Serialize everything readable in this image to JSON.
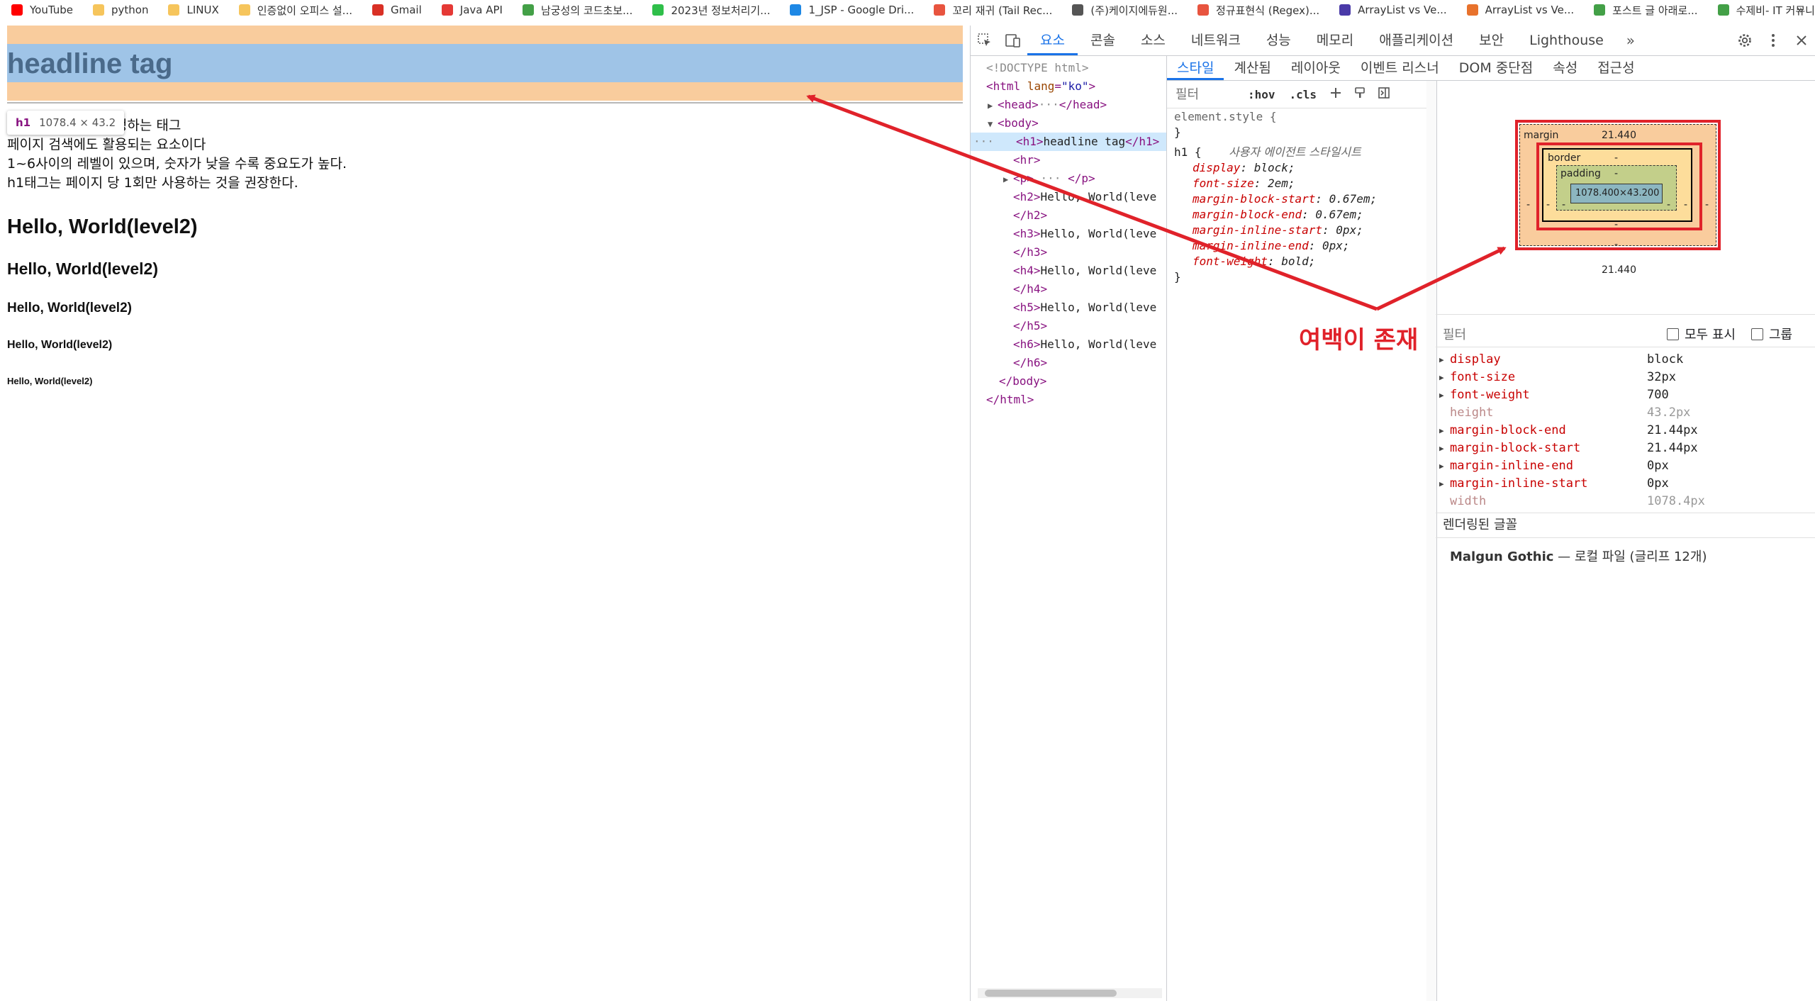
{
  "bookmarks": [
    {
      "label": "YouTube",
      "color": "#ff0000"
    },
    {
      "label": "python",
      "color": "#f6c55c"
    },
    {
      "label": "LINUX",
      "color": "#f6c55c"
    },
    {
      "label": "인증없이 오피스 설...",
      "color": "#f6c55c"
    },
    {
      "label": "Gmail",
      "color": "#d93025"
    },
    {
      "label": "Java API",
      "color": "#e53935"
    },
    {
      "label": "남궁성의 코드초보...",
      "color": "#43a047"
    },
    {
      "label": "2023년 정보처리기...",
      "color": "#2fbf4a"
    },
    {
      "label": "1_JSP - Google Dri...",
      "color": "#1e88e5"
    },
    {
      "label": "꼬리 재귀 (Tail Rec...",
      "color": "#e8543f"
    },
    {
      "label": "(주)케이지에듀원...",
      "color": "#555555"
    },
    {
      "label": "정규표현식 (Regex)...",
      "color": "#e8543f"
    },
    {
      "label": "ArrayList vs Ve...",
      "color": "#4a3aa8"
    },
    {
      "label": "ArrayList vs Ve...",
      "color": "#e8722c"
    },
    {
      "label": "포스트 글 아래로...",
      "color": "#43a047"
    },
    {
      "label": "수제비- IT 커뮤니...",
      "color": "#43a047"
    }
  ],
  "bookmarks_more": "»",
  "page": {
    "h1": "headline tag",
    "tooltip_tag": "h1",
    "tooltip_dim": "1078.4 × 43.2",
    "paragraph": [
      "웹문서의 제목을 설정하는 태그",
      "페이지 검색에도 활용되는 요소이다",
      "1~6사이의 레벨이 있으며, 숫자가 낮을 수록 중요도가 높다.",
      "h1태그는 페이지 당 1회만 사용하는 것을 권장한다."
    ],
    "headings": [
      "Hello, World(level2)",
      "Hello, World(level2)",
      "Hello, World(level2)",
      "Hello, World(level2)",
      "Hello, World(level2)"
    ]
  },
  "devtools": {
    "tabs": [
      "요소",
      "콘솔",
      "소스",
      "네트워크",
      "성능",
      "메모리",
      "애플리케이션",
      "보안",
      "Lighthouse"
    ],
    "active_tab": "요소",
    "more_tabs": "»",
    "sub_tabs": [
      "스타일",
      "계산됨",
      "레이아웃",
      "이벤트 리스너",
      "DOM 중단점",
      "속성",
      "접근성"
    ],
    "active_sub_tab": "스타일",
    "tree": {
      "doctype": "<!DOCTYPE html>",
      "html_open": "<html",
      "lang_attr": "lang",
      "lang_val": "\"ko\"",
      "head": "<head>",
      "head_close": "</head>",
      "ellipsis": "···",
      "body_open": "<body>",
      "h1_open": "<h1>",
      "h1_text": "headline tag",
      "h1_close": "</h1>",
      "sel_dots": "···",
      "hr": "<hr>",
      "p_open": "<p>",
      "p_close": "</p>",
      "h_lines": [
        {
          "open": "<h2>",
          "text": "Hello, World(leve",
          "close": "</h2>"
        },
        {
          "open": "<h3>",
          "text": "Hello, World(leve",
          "close": "</h3>"
        },
        {
          "open": "<h4>",
          "text": "Hello, World(leve",
          "close": "</h4>"
        },
        {
          "open": "<h5>",
          "text": "Hello, World(leve",
          "close": "</h5>"
        },
        {
          "open": "<h6>",
          "text": "Hello, World(leve",
          "close": "</h6>"
        }
      ],
      "body_close": "</body>",
      "html_close": "</html>"
    },
    "styles": {
      "filter_placeholder": "필터",
      "hov": ":hov",
      "cls": ".cls",
      "element_style": "element.style {",
      "close_brace": "}",
      "rule_selector": "h1 {",
      "ua_label": "사용자 에이전트 스타일시트",
      "declarations": [
        {
          "p": "display",
          "v": "block;"
        },
        {
          "p": "font-size",
          "v": "2em;"
        },
        {
          "p": "margin-block-start",
          "v": "0.67em;"
        },
        {
          "p": "margin-block-end",
          "v": "0.67em;"
        },
        {
          "p": "margin-inline-start",
          "v": "0px;"
        },
        {
          "p": "margin-inline-end",
          "v": "0px;"
        },
        {
          "p": "font-weight",
          "v": "bold;"
        }
      ]
    },
    "boxmodel": {
      "margin_label": "margin",
      "margin_top": "21.440",
      "margin_bottom": "21.440",
      "margin_left": "-",
      "margin_right": "-",
      "border_label": "border",
      "border_top": "-",
      "border_bottom": "-",
      "border_left": "-",
      "border_right": "-",
      "padding_label": "padding",
      "padding_top": "-",
      "padding_bottom": "-",
      "padding_left": "-",
      "padding_right": "-",
      "content": "1078.400×43.200"
    },
    "computed": {
      "filter_label": "필터",
      "show_all": "모두 표시",
      "group": "그룹",
      "props": [
        {
          "name": "display",
          "value": "block",
          "dim": false
        },
        {
          "name": "font-size",
          "value": "32px",
          "dim": false
        },
        {
          "name": "font-weight",
          "value": "700",
          "dim": false
        },
        {
          "name": "height",
          "value": "43.2px",
          "dim": true
        },
        {
          "name": "margin-block-end",
          "value": "21.44px",
          "dim": false
        },
        {
          "name": "margin-block-start",
          "value": "21.44px",
          "dim": false
        },
        {
          "name": "margin-inline-end",
          "value": "0px",
          "dim": false
        },
        {
          "name": "margin-inline-start",
          "value": "0px",
          "dim": false
        },
        {
          "name": "width",
          "value": "1078.4px",
          "dim": true
        }
      ],
      "rendered_fonts_label": "렌더링된 글꼴",
      "font_name": "Malgun Gothic",
      "font_desc": "— 로컬 파일 (글리프 12개)"
    }
  },
  "annotation": {
    "label": "여백이 존재",
    "color": "#e0222a"
  }
}
